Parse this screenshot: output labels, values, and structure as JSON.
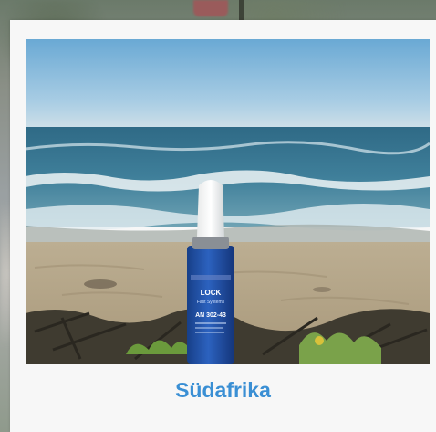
{
  "caption": "Südafrika",
  "product": {
    "brand": "LOCK",
    "sub": "Fast Systems",
    "code": "AN 302-43"
  },
  "colors": {
    "caption": "#3a8fd4",
    "bottle": "#1e4fa6",
    "sky": "#7fb6d9",
    "sea": "#3f7894",
    "sand": "#b8a88a"
  }
}
